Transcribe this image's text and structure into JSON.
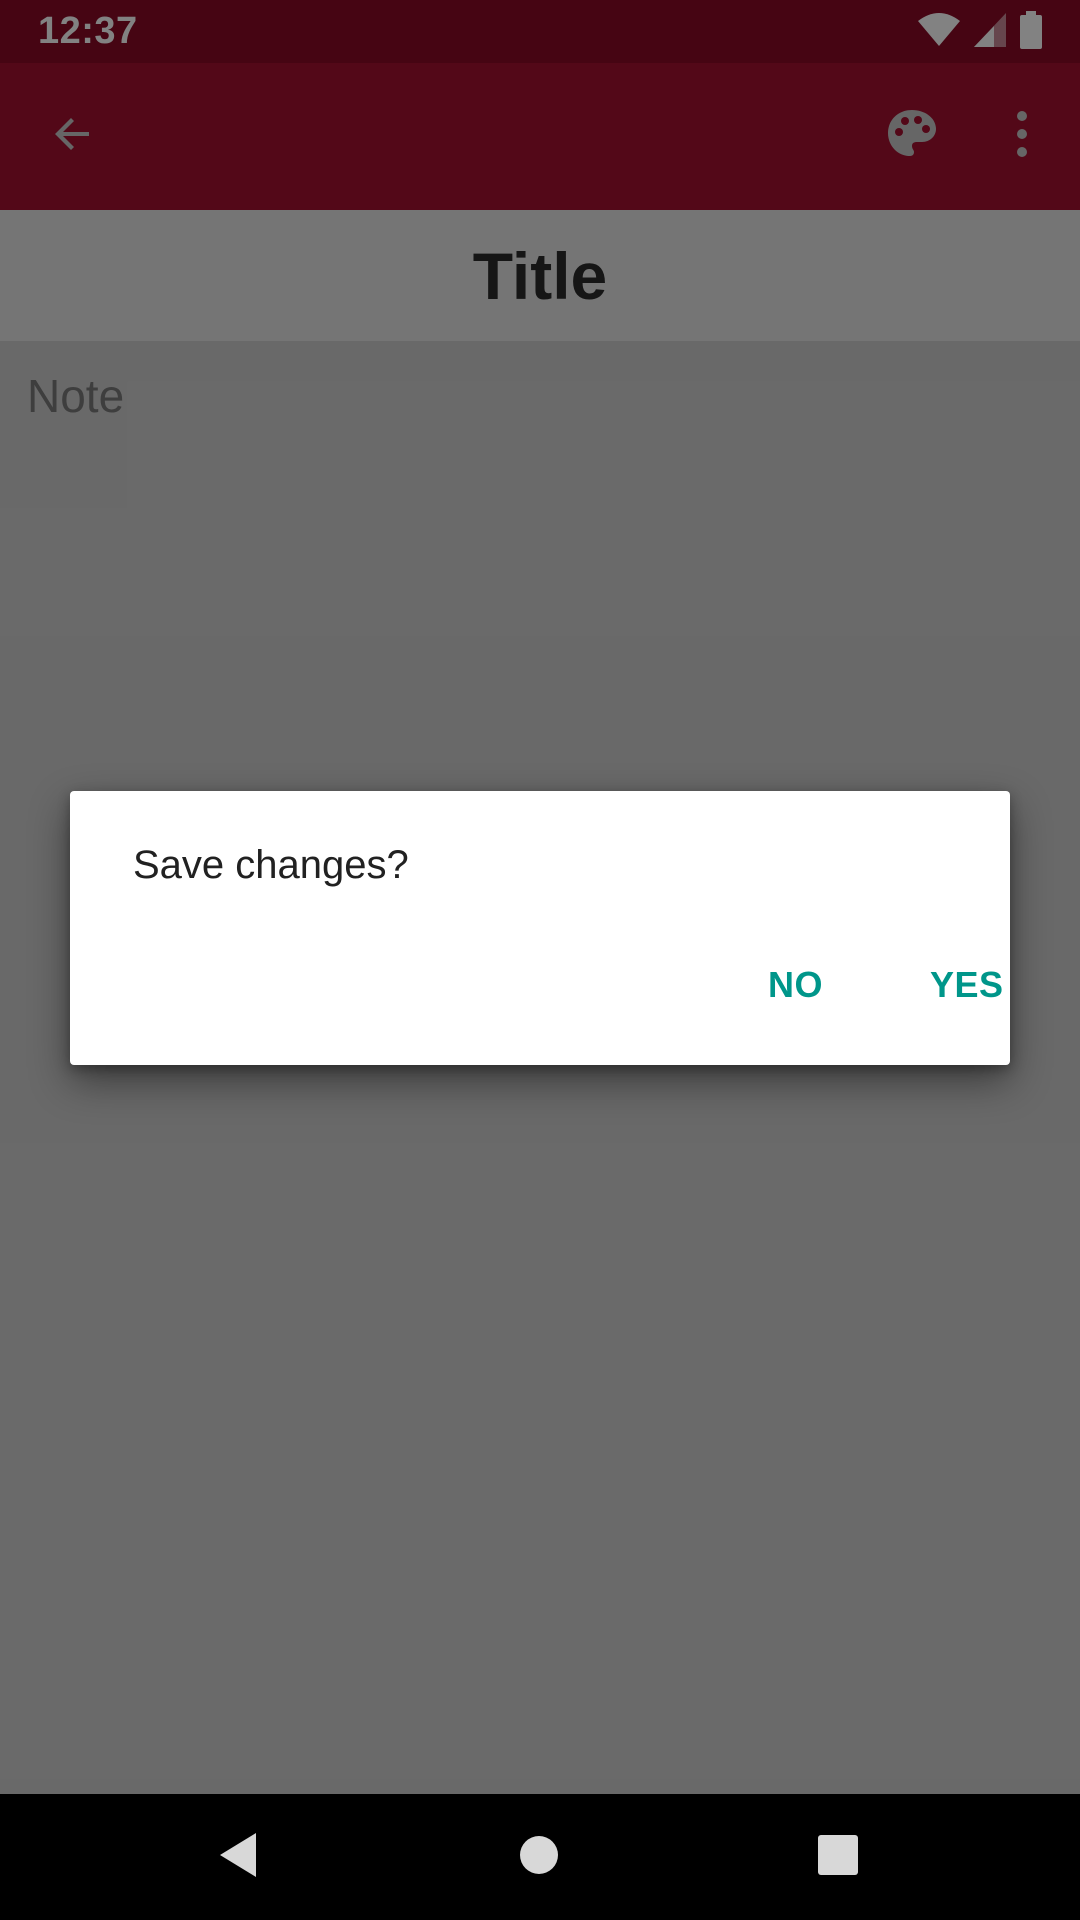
{
  "status_bar": {
    "time": "12:37",
    "icons": [
      "wifi-icon",
      "cell-signal-icon",
      "battery-icon"
    ]
  },
  "app_bar": {
    "icons": [
      "arrow-back-icon",
      "palette-icon",
      "more-vert-icon"
    ],
    "color": "#a4102f"
  },
  "editor": {
    "title_placeholder": "Title",
    "note_placeholder": "Note"
  },
  "dialog": {
    "message": "Save changes?",
    "no_label": "NO",
    "yes_label": "YES",
    "accent_color": "#00968a"
  },
  "nav_bar": {
    "icons": [
      "nav-back-icon",
      "nav-home-icon",
      "nav-recents-icon"
    ]
  }
}
